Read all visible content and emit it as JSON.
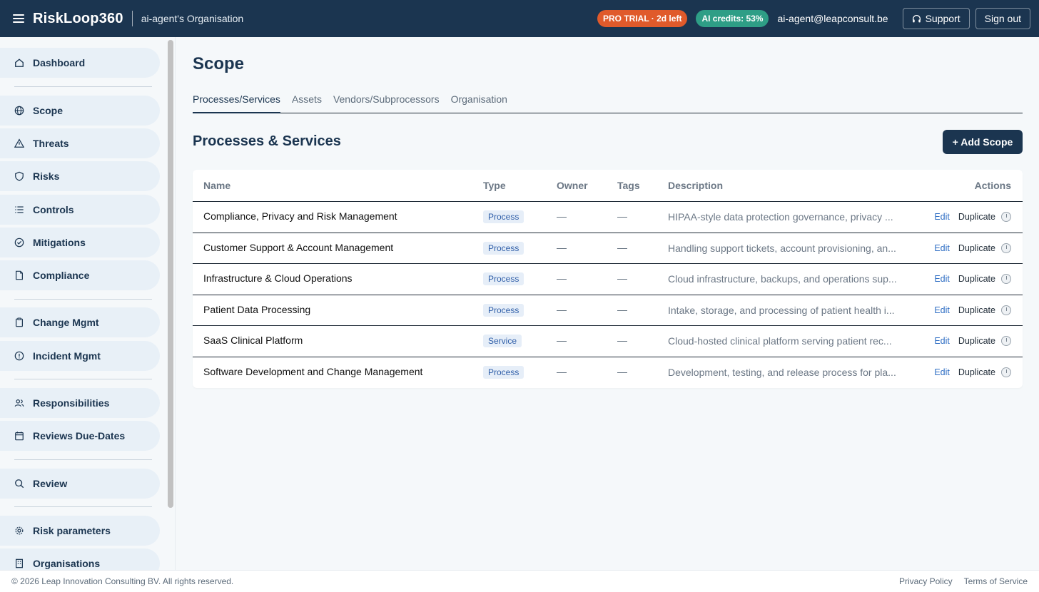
{
  "header": {
    "brand": "RiskLoop360",
    "org_name": "ai-agent's Organisation",
    "trial_badge": "PRO TRIAL · 2d left",
    "credits_badge": "AI credits: 53%",
    "user_email": "ai-agent@leapconsult.be",
    "support_label": "Support",
    "signout_label": "Sign out",
    "colors": {
      "bar": "#1b3550",
      "trial": "#e05a2b",
      "credits": "#2e9e86"
    }
  },
  "sidebar": {
    "items": [
      {
        "label": "Dashboard",
        "icon": "home-icon"
      },
      {
        "label": "Scope",
        "icon": "globe-icon"
      },
      {
        "label": "Threats",
        "icon": "warning-icon"
      },
      {
        "label": "Risks",
        "icon": "shield-icon"
      },
      {
        "label": "Controls",
        "icon": "list-icon"
      },
      {
        "label": "Mitigations",
        "icon": "check-circle-icon"
      },
      {
        "label": "Compliance",
        "icon": "document-icon"
      },
      {
        "label": "Change Mgmt",
        "icon": "clipboard-icon"
      },
      {
        "label": "Incident Mgmt",
        "icon": "alert-circle-icon"
      },
      {
        "label": "Responsibilities",
        "icon": "users-icon"
      },
      {
        "label": "Reviews Due-Dates",
        "icon": "calendar-icon"
      },
      {
        "label": "Review",
        "icon": "search-icon"
      },
      {
        "label": "Risk parameters",
        "icon": "gear-icon"
      },
      {
        "label": "Organisations",
        "icon": "building-icon"
      }
    ]
  },
  "main": {
    "title": "Scope",
    "tabs": [
      "Processes/Services",
      "Assets",
      "Vendors/Subprocessors",
      "Organisation"
    ],
    "active_tab": "Processes/Services",
    "section_title": "Processes & Services",
    "add_button": "+ Add Scope",
    "table": {
      "headers": [
        "Name",
        "Type",
        "Owner",
        "Tags",
        "Description",
        "Actions"
      ],
      "rows": [
        {
          "name": "Compliance, Privacy and Risk Management",
          "type": "Process",
          "owner": "—",
          "tags": "—",
          "description": "HIPAA-style data protection governance, privacy ...",
          "edit": "Edit",
          "duplicate": "Duplicate"
        },
        {
          "name": "Customer Support & Account Management",
          "type": "Process",
          "owner": "—",
          "tags": "—",
          "description": "Handling support tickets, account provisioning, an...",
          "edit": "Edit",
          "duplicate": "Duplicate"
        },
        {
          "name": "Infrastructure & Cloud Operations",
          "type": "Process",
          "owner": "—",
          "tags": "—",
          "description": "Cloud infrastructure, backups, and operations sup...",
          "edit": "Edit",
          "duplicate": "Duplicate"
        },
        {
          "name": "Patient Data Processing",
          "type": "Process",
          "owner": "—",
          "tags": "—",
          "description": "Intake, storage, and processing of patient health i...",
          "edit": "Edit",
          "duplicate": "Duplicate"
        },
        {
          "name": "SaaS Clinical Platform",
          "type": "Service",
          "owner": "—",
          "tags": "—",
          "description": "Cloud-hosted clinical platform serving patient rec...",
          "edit": "Edit",
          "duplicate": "Duplicate"
        },
        {
          "name": "Software Development and Change Management",
          "type": "Process",
          "owner": "—",
          "tags": "—",
          "description": "Development, testing, and release process for pla...",
          "edit": "Edit",
          "duplicate": "Duplicate"
        }
      ]
    }
  },
  "footer": {
    "copyright": "© 2026 Leap Innovation Consulting BV. All rights reserved.",
    "privacy": "Privacy Policy",
    "terms": "Terms of Service"
  }
}
